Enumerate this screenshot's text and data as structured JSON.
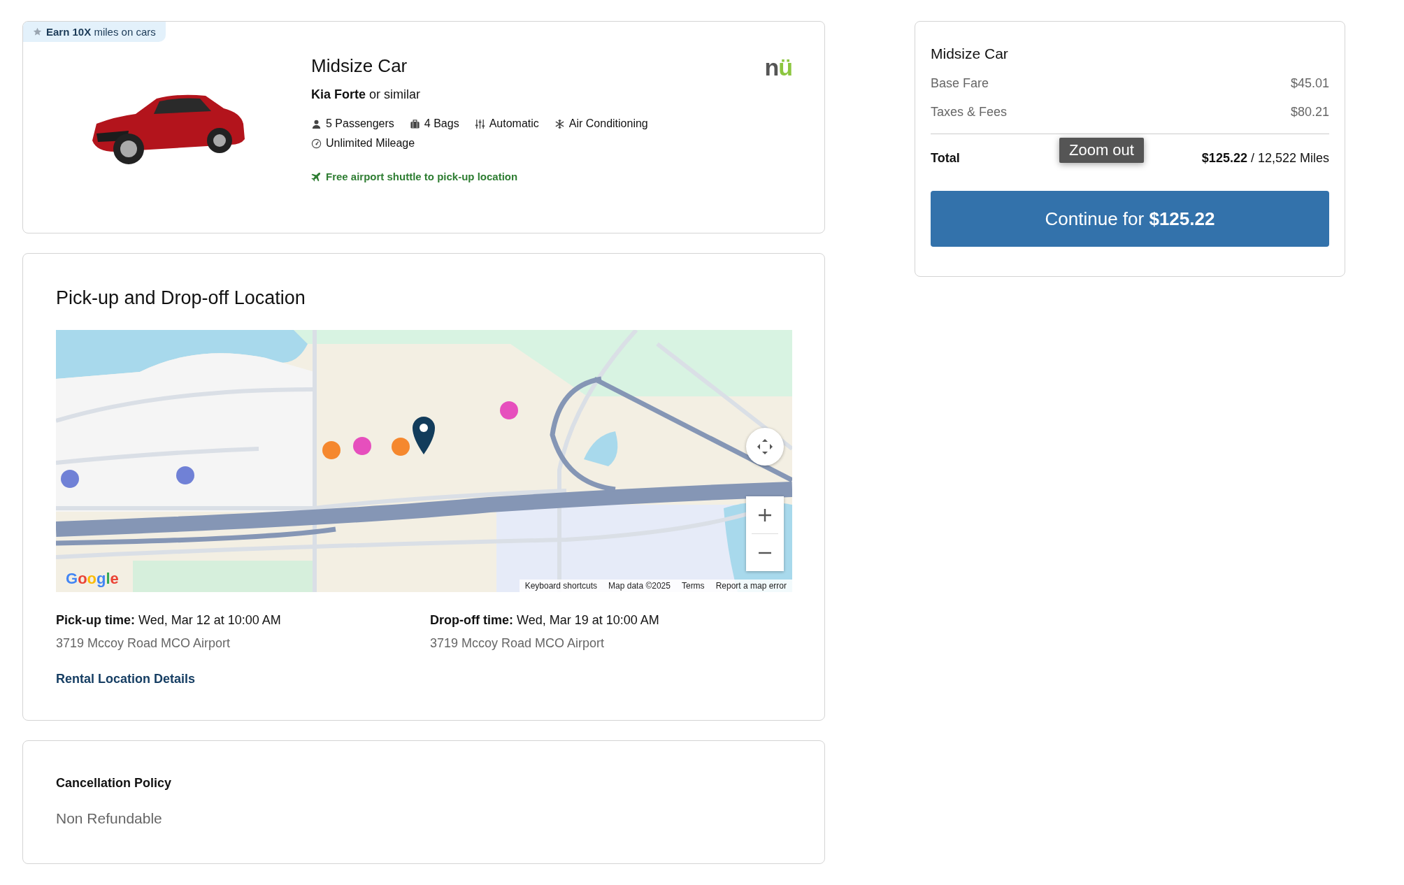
{
  "promo_badge": {
    "text": "**Earn 10X** miles on cars"
  },
  "car": {
    "category": "Midsize Car",
    "vendor_logo": "nü",
    "model": "**Kia Forte** or similar",
    "features": [
      {
        "kind": "passengers",
        "label": "5 Passengers"
      },
      {
        "kind": "bags",
        "label": "4 Bags"
      },
      {
        "kind": "transmission",
        "label": "Automatic"
      },
      {
        "kind": "air",
        "label": "Air Conditioning"
      },
      {
        "kind": "mileage",
        "label": "Unlimited Mileage"
      }
    ],
    "shuttle": "Free airport shuttle to pick-up location"
  },
  "location": {
    "title": "Pick-up and Drop-off Location",
    "map": {
      "logo": "Google",
      "footer_links": [
        "Keyboard shortcuts",
        "Map data ©2025",
        "Terms",
        "Report a map error"
      ]
    },
    "pickup": {
      "label": "Pick-up time:",
      "time": "Wed, Mar 12 at 10:00 AM",
      "address": "3719 Mccoy Road MCO Airport"
    },
    "dropoff": {
      "label": "Drop-off time:",
      "time": "Wed, Mar 19 at 10:00 AM",
      "address": "3719 Mccoy Road MCO Airport"
    },
    "details_link": "Rental Location Details"
  },
  "cancellation": {
    "title": "Cancellation Policy",
    "text": "Non Refundable"
  },
  "summary": {
    "title": "Midsize Car",
    "lines": [
      {
        "label": "Base Fare",
        "amount": "$45.01"
      },
      {
        "label": "Taxes & Fees",
        "amount": "$80.21"
      }
    ],
    "total_label": "Total",
    "total_value": "**$125.22** / 12,522 Miles",
    "button": "Continue for **$125.22**"
  },
  "tooltip": {
    "text": "Zoom out"
  }
}
